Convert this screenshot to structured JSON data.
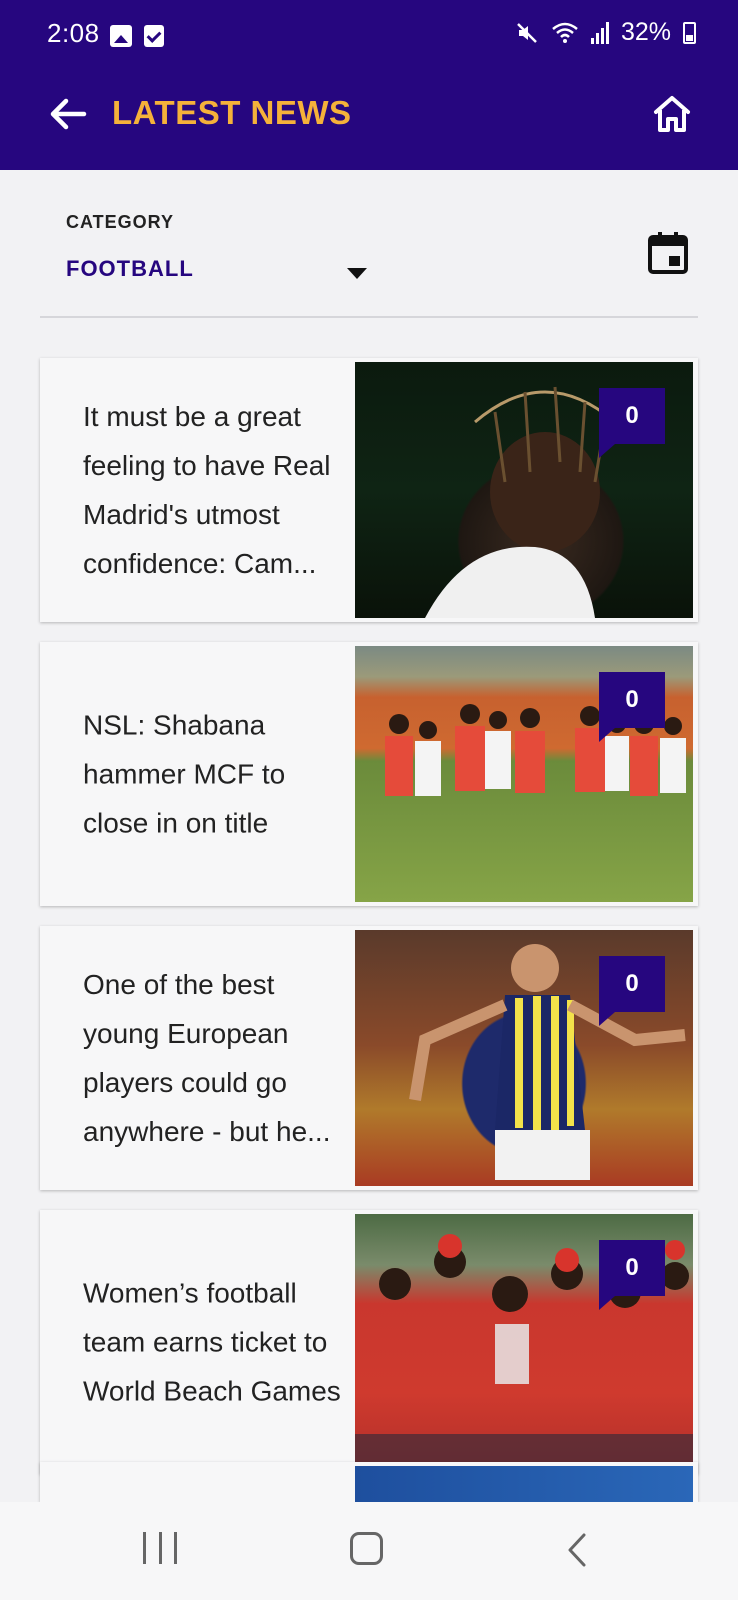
{
  "status_bar": {
    "time": "2:08",
    "battery": "32%",
    "icons": [
      "image-icon",
      "checkbox-icon",
      "mute-icon",
      "wifi-icon",
      "signal-icon",
      "battery-icon"
    ]
  },
  "app_bar": {
    "title": "LATEST NEWS",
    "back_icon": "arrow-left-icon",
    "home_icon": "home-icon"
  },
  "filter": {
    "label": "CATEGORY",
    "selected": "FOOTBALL",
    "calendar_icon": "calendar-icon"
  },
  "articles": [
    {
      "headline": "It must be a great feeling to have Real Madrid's utmost confidence: Cam...",
      "comments": "0"
    },
    {
      "headline": "NSL: Shabana hammer MCF to close in on title",
      "comments": "0"
    },
    {
      "headline": "One of the best young European players could go anywhere - but he...",
      "comments": "0"
    },
    {
      "headline": "Women’s football team earns ticket to World Beach Games",
      "comments": "0"
    }
  ],
  "colors": {
    "primary": "#26067f",
    "accent": "#f5b13a",
    "background": "#f2f2f4"
  }
}
